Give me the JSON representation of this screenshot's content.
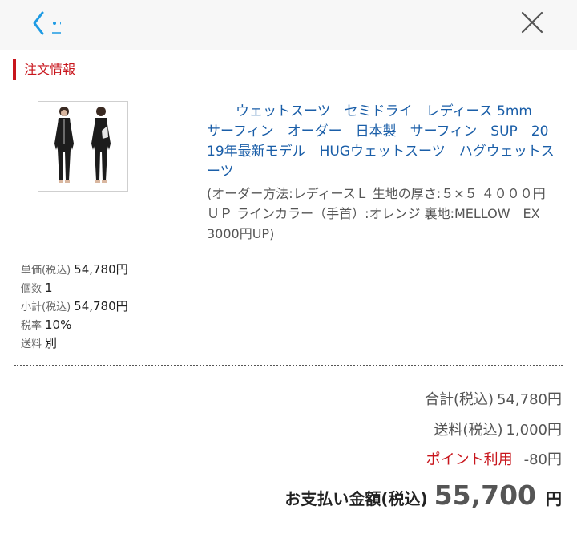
{
  "header": {
    "back_icon": "chevron-left-icon",
    "more_icon": "ellipsis-icon",
    "close_icon": "close-icon",
    "accent": "#1e9be4"
  },
  "section": {
    "title": "注文情報",
    "accent": "#c8161d"
  },
  "product": {
    "title": "ウェットスーツ　セミドライ　レディース 5mm　サーフィン　オーダー　日本製　サーフィン　SUP　2019年最新モデル　HUGウェットスーツ　ハグウェットスーツ",
    "options": "(オーダー方法:レディースＬ 生地の厚さ:５×５ ４０００円ＵＰ ラインカラー（手首）:オレンジ 裏地:MELLOW　EX　　3000円UP)",
    "link_color": "#1a5ea8"
  },
  "details": [
    {
      "label": "単価(税込)",
      "value": "54,780円"
    },
    {
      "label": "個数",
      "value": "1"
    },
    {
      "label": "小計(税込)",
      "value": "54,780円"
    },
    {
      "label": "税率",
      "value": "10%"
    },
    {
      "label": "送料",
      "value": "別"
    }
  ],
  "totals": {
    "subtotal_label": "合計(税込)",
    "subtotal_value": "54,780円",
    "shipping_label": "送料(税込)",
    "shipping_value": "1,000円",
    "points_label": "ポイント利用",
    "points_value": "-80円",
    "points_color": "#c8161d",
    "final_label": "お支払い金額(税込)",
    "final_amount": "55,700",
    "final_unit": "円"
  }
}
